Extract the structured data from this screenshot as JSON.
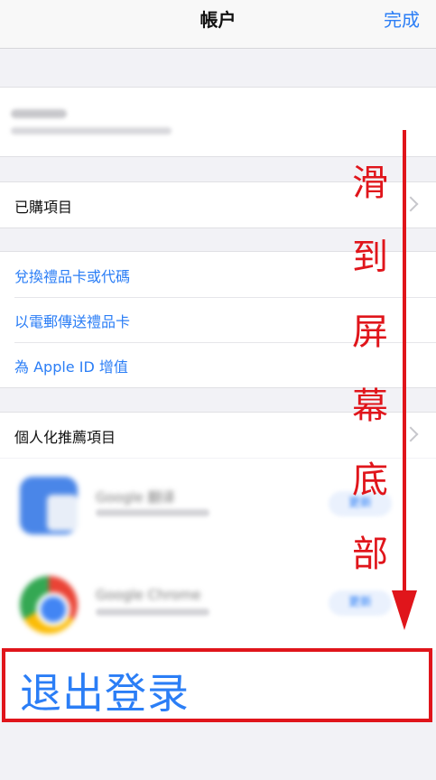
{
  "navbar": {
    "title": "帳户",
    "done_label": "完成"
  },
  "groups": {
    "purchased": {
      "label": "已購項目"
    },
    "gift": {
      "items": [
        {
          "label": "兌換禮品卡或代碼"
        },
        {
          "label": "以電郵傳送禮品卡"
        },
        {
          "label": "為 Apple ID 增值"
        }
      ]
    },
    "personalized": {
      "label": "個人化推薦項目"
    }
  },
  "apps": [
    {
      "name": "Google 翻译",
      "icon": "google-translate-icon",
      "button": "更新"
    },
    {
      "name": "Google Chrome",
      "icon": "google-chrome-icon",
      "button": "更新"
    }
  ],
  "signout": {
    "label": "退出登录"
  },
  "annotation": {
    "chars": [
      "滑",
      "到",
      "屏",
      "幕",
      "底",
      "部"
    ],
    "color": "#e0151b"
  },
  "colors": {
    "link": "#2b7ef6",
    "highlight": "#e0151b",
    "background": "#f2f2f6"
  }
}
